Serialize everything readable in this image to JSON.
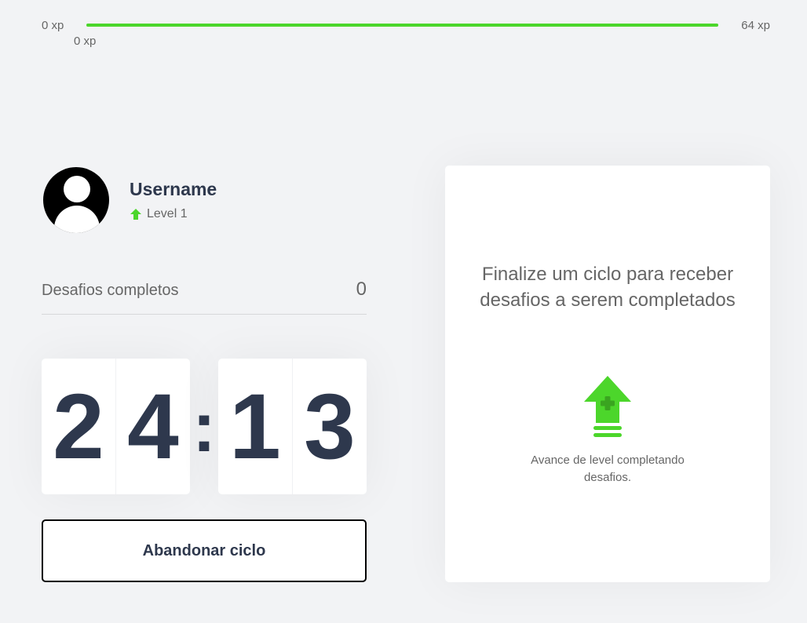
{
  "experience": {
    "start_label": "0 xp",
    "end_label": "64 xp",
    "current_label": "0 xp",
    "progress_percent": 100,
    "bar_color": "#4cd62b"
  },
  "profile": {
    "name": "Username",
    "level_label": "Level 1",
    "level_icon": "level-up-arrow-icon",
    "avatar_icon": "user-avatar-icon"
  },
  "challenges": {
    "label": "Desafios completos",
    "count": "0"
  },
  "countdown": {
    "minutes": [
      "2",
      "4"
    ],
    "separator": ":",
    "seconds": [
      "1",
      "3"
    ]
  },
  "actions": {
    "abandon_label": "Abandonar ciclo"
  },
  "challenge_box": {
    "title": "Finalize um ciclo para receber desafios a serem completados",
    "icon": "level-up-icon",
    "text": "Avance de level completando desafios."
  },
  "colors": {
    "accent_green": "#4cd62b",
    "text_dark": "#2e384d",
    "text_muted": "#666666",
    "background": "#f2f3f5"
  }
}
